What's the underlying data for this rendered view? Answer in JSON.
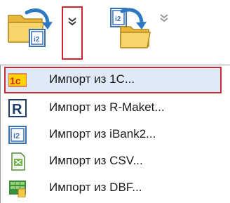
{
  "toolbar": {
    "import_icon": "folder-import-icon",
    "dropdown_icon": "chevron-double-down-icon",
    "export_icon": "folder-export-icon",
    "dropdown2_icon": "chevron-double-down-icon"
  },
  "menu": {
    "items": [
      {
        "label": "Импорт из 1С...",
        "icon": "1c-logo-icon",
        "selected": true
      },
      {
        "label": "Импорт из R-Maket...",
        "icon": "r-maket-icon",
        "selected": false
      },
      {
        "label": "Импорт из iBank2...",
        "icon": "ibank2-icon",
        "selected": false
      },
      {
        "label": "Импорт из CSV...",
        "icon": "csv-file-icon",
        "selected": false
      },
      {
        "label": "Импорт из DBF...",
        "icon": "dbf-file-icon",
        "selected": false
      }
    ]
  },
  "colors": {
    "highlight_border": "#cc2a36",
    "highlight_bg": "#dfe9f7",
    "folder_yellow": "#f2c94c",
    "arrow_blue": "#2f78c4",
    "c1_red": "#d0252e",
    "c1_yellow": "#ffd200"
  }
}
